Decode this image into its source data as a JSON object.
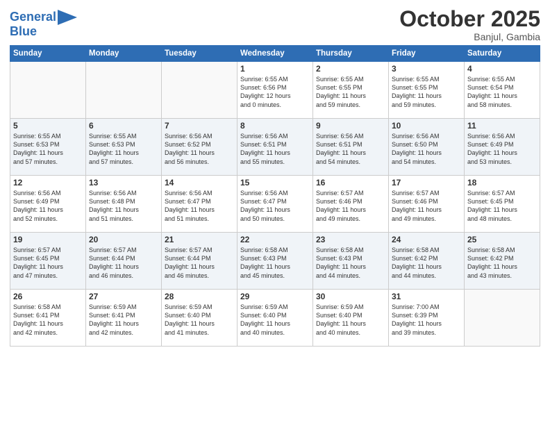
{
  "header": {
    "logo_line1": "General",
    "logo_line2": "Blue",
    "month": "October 2025",
    "location": "Banjul, Gambia"
  },
  "weekdays": [
    "Sunday",
    "Monday",
    "Tuesday",
    "Wednesday",
    "Thursday",
    "Friday",
    "Saturday"
  ],
  "weeks": [
    [
      {
        "day": "",
        "info": ""
      },
      {
        "day": "",
        "info": ""
      },
      {
        "day": "",
        "info": ""
      },
      {
        "day": "1",
        "info": "Sunrise: 6:55 AM\nSunset: 6:56 PM\nDaylight: 12 hours\nand 0 minutes."
      },
      {
        "day": "2",
        "info": "Sunrise: 6:55 AM\nSunset: 6:55 PM\nDaylight: 11 hours\nand 59 minutes."
      },
      {
        "day": "3",
        "info": "Sunrise: 6:55 AM\nSunset: 6:55 PM\nDaylight: 11 hours\nand 59 minutes."
      },
      {
        "day": "4",
        "info": "Sunrise: 6:55 AM\nSunset: 6:54 PM\nDaylight: 11 hours\nand 58 minutes."
      }
    ],
    [
      {
        "day": "5",
        "info": "Sunrise: 6:55 AM\nSunset: 6:53 PM\nDaylight: 11 hours\nand 57 minutes."
      },
      {
        "day": "6",
        "info": "Sunrise: 6:55 AM\nSunset: 6:53 PM\nDaylight: 11 hours\nand 57 minutes."
      },
      {
        "day": "7",
        "info": "Sunrise: 6:56 AM\nSunset: 6:52 PM\nDaylight: 11 hours\nand 56 minutes."
      },
      {
        "day": "8",
        "info": "Sunrise: 6:56 AM\nSunset: 6:51 PM\nDaylight: 11 hours\nand 55 minutes."
      },
      {
        "day": "9",
        "info": "Sunrise: 6:56 AM\nSunset: 6:51 PM\nDaylight: 11 hours\nand 54 minutes."
      },
      {
        "day": "10",
        "info": "Sunrise: 6:56 AM\nSunset: 6:50 PM\nDaylight: 11 hours\nand 54 minutes."
      },
      {
        "day": "11",
        "info": "Sunrise: 6:56 AM\nSunset: 6:49 PM\nDaylight: 11 hours\nand 53 minutes."
      }
    ],
    [
      {
        "day": "12",
        "info": "Sunrise: 6:56 AM\nSunset: 6:49 PM\nDaylight: 11 hours\nand 52 minutes."
      },
      {
        "day": "13",
        "info": "Sunrise: 6:56 AM\nSunset: 6:48 PM\nDaylight: 11 hours\nand 51 minutes."
      },
      {
        "day": "14",
        "info": "Sunrise: 6:56 AM\nSunset: 6:47 PM\nDaylight: 11 hours\nand 51 minutes."
      },
      {
        "day": "15",
        "info": "Sunrise: 6:56 AM\nSunset: 6:47 PM\nDaylight: 11 hours\nand 50 minutes."
      },
      {
        "day": "16",
        "info": "Sunrise: 6:57 AM\nSunset: 6:46 PM\nDaylight: 11 hours\nand 49 minutes."
      },
      {
        "day": "17",
        "info": "Sunrise: 6:57 AM\nSunset: 6:46 PM\nDaylight: 11 hours\nand 49 minutes."
      },
      {
        "day": "18",
        "info": "Sunrise: 6:57 AM\nSunset: 6:45 PM\nDaylight: 11 hours\nand 48 minutes."
      }
    ],
    [
      {
        "day": "19",
        "info": "Sunrise: 6:57 AM\nSunset: 6:45 PM\nDaylight: 11 hours\nand 47 minutes."
      },
      {
        "day": "20",
        "info": "Sunrise: 6:57 AM\nSunset: 6:44 PM\nDaylight: 11 hours\nand 46 minutes."
      },
      {
        "day": "21",
        "info": "Sunrise: 6:57 AM\nSunset: 6:44 PM\nDaylight: 11 hours\nand 46 minutes."
      },
      {
        "day": "22",
        "info": "Sunrise: 6:58 AM\nSunset: 6:43 PM\nDaylight: 11 hours\nand 45 minutes."
      },
      {
        "day": "23",
        "info": "Sunrise: 6:58 AM\nSunset: 6:43 PM\nDaylight: 11 hours\nand 44 minutes."
      },
      {
        "day": "24",
        "info": "Sunrise: 6:58 AM\nSunset: 6:42 PM\nDaylight: 11 hours\nand 44 minutes."
      },
      {
        "day": "25",
        "info": "Sunrise: 6:58 AM\nSunset: 6:42 PM\nDaylight: 11 hours\nand 43 minutes."
      }
    ],
    [
      {
        "day": "26",
        "info": "Sunrise: 6:58 AM\nSunset: 6:41 PM\nDaylight: 11 hours\nand 42 minutes."
      },
      {
        "day": "27",
        "info": "Sunrise: 6:59 AM\nSunset: 6:41 PM\nDaylight: 11 hours\nand 42 minutes."
      },
      {
        "day": "28",
        "info": "Sunrise: 6:59 AM\nSunset: 6:40 PM\nDaylight: 11 hours\nand 41 minutes."
      },
      {
        "day": "29",
        "info": "Sunrise: 6:59 AM\nSunset: 6:40 PM\nDaylight: 11 hours\nand 40 minutes."
      },
      {
        "day": "30",
        "info": "Sunrise: 6:59 AM\nSunset: 6:40 PM\nDaylight: 11 hours\nand 40 minutes."
      },
      {
        "day": "31",
        "info": "Sunrise: 7:00 AM\nSunset: 6:39 PM\nDaylight: 11 hours\nand 39 minutes."
      },
      {
        "day": "",
        "info": ""
      }
    ]
  ]
}
